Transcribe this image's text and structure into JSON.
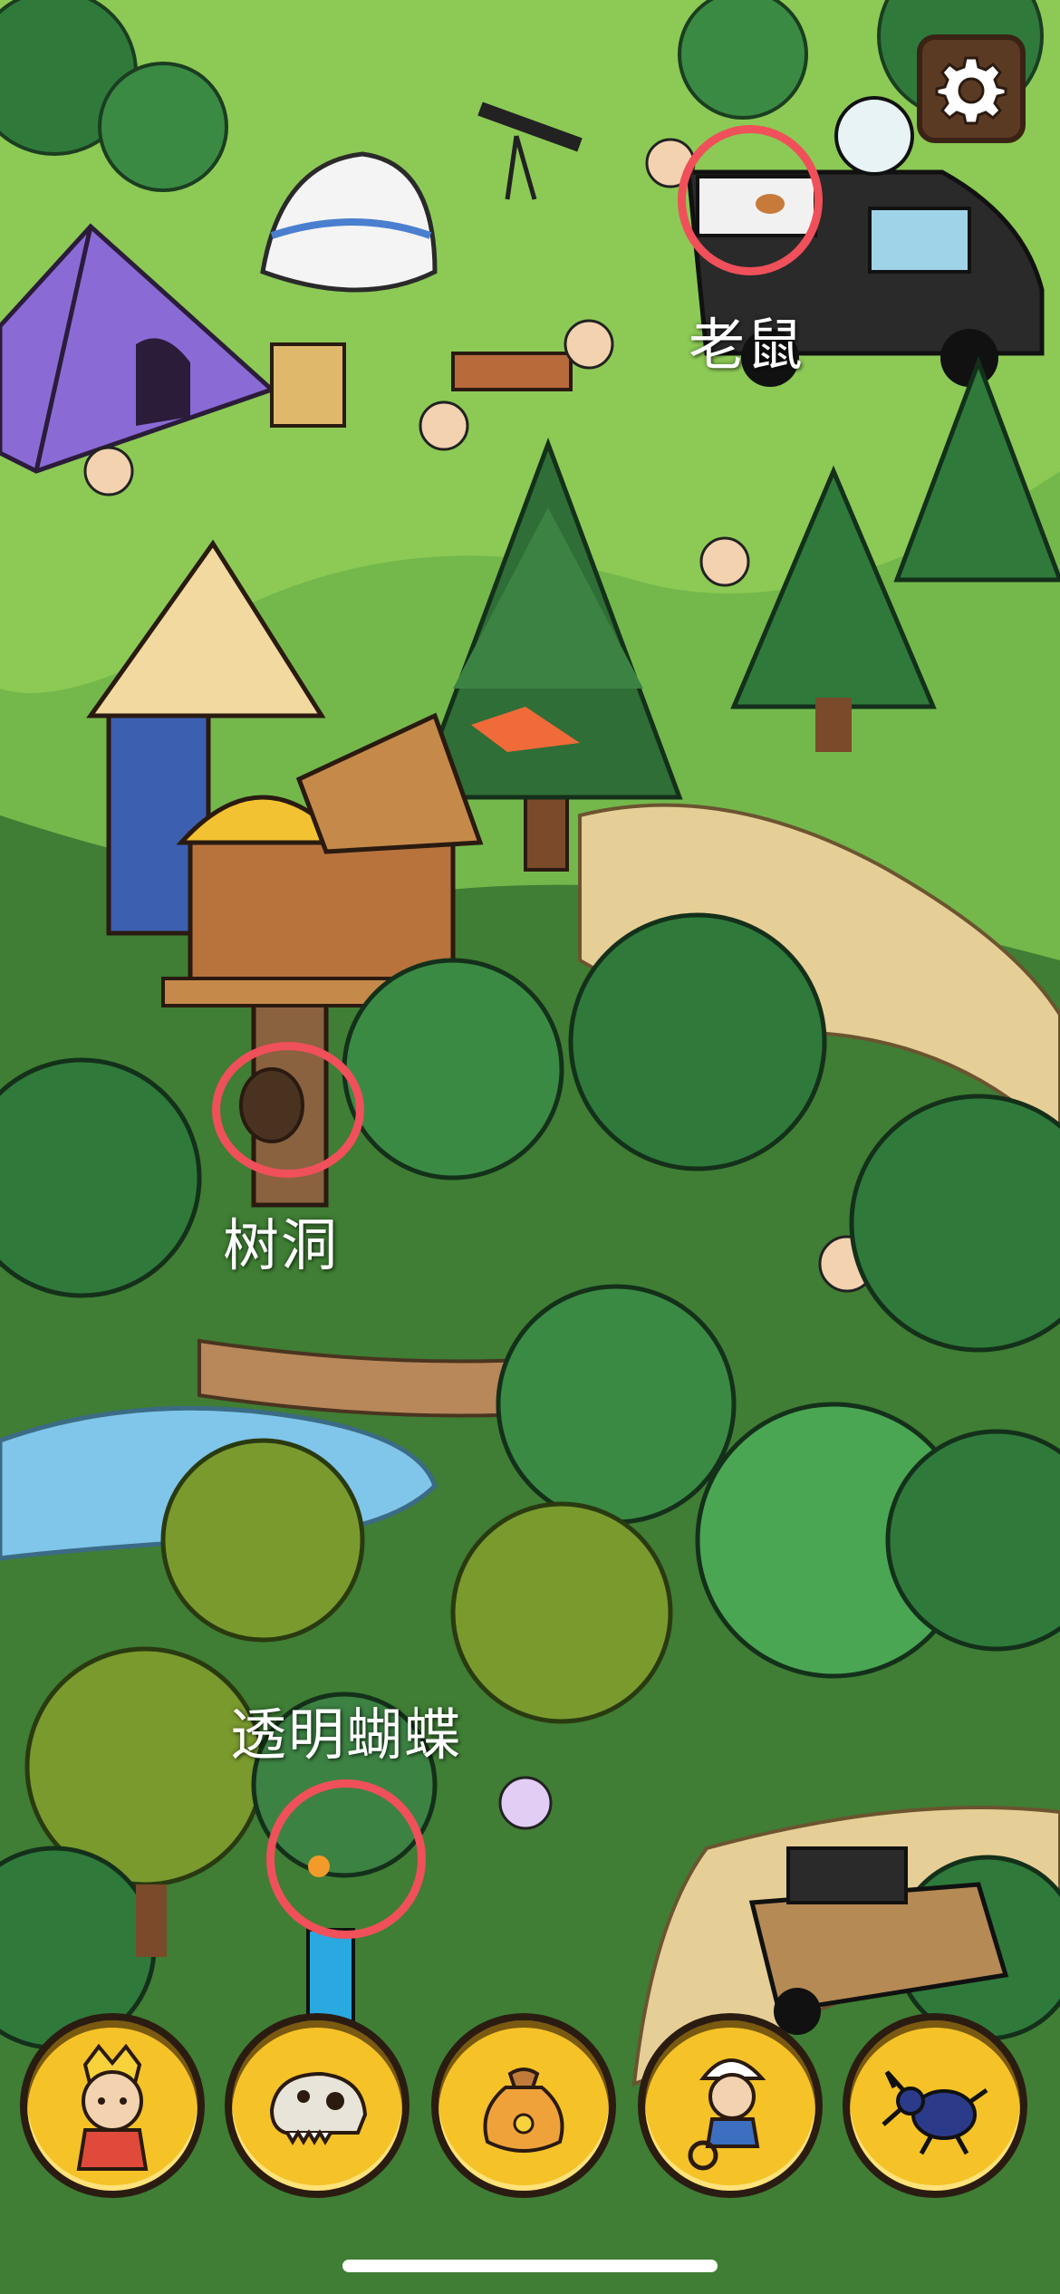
{
  "game": {
    "hints": [
      {
        "id": "mouse",
        "label": "老鼠"
      },
      {
        "id": "tree-hole",
        "label": "树洞"
      },
      {
        "id": "transparent-butterfly",
        "label": "透明蝴蝶"
      }
    ],
    "settings_icon": "gear-icon",
    "toolbar": [
      {
        "id": "character",
        "icon": "crowned-kid-icon"
      },
      {
        "id": "fossil",
        "icon": "dinosaur-skull-icon"
      },
      {
        "id": "pouch",
        "icon": "pouch-icon"
      },
      {
        "id": "cyclist",
        "icon": "cyclist-icon"
      },
      {
        "id": "beetle",
        "icon": "beetle-icon"
      }
    ],
    "colors": {
      "hint_circle": "#f0505a",
      "toolbar_button": "#f5c228",
      "settings_button": "#5b3a24"
    }
  }
}
